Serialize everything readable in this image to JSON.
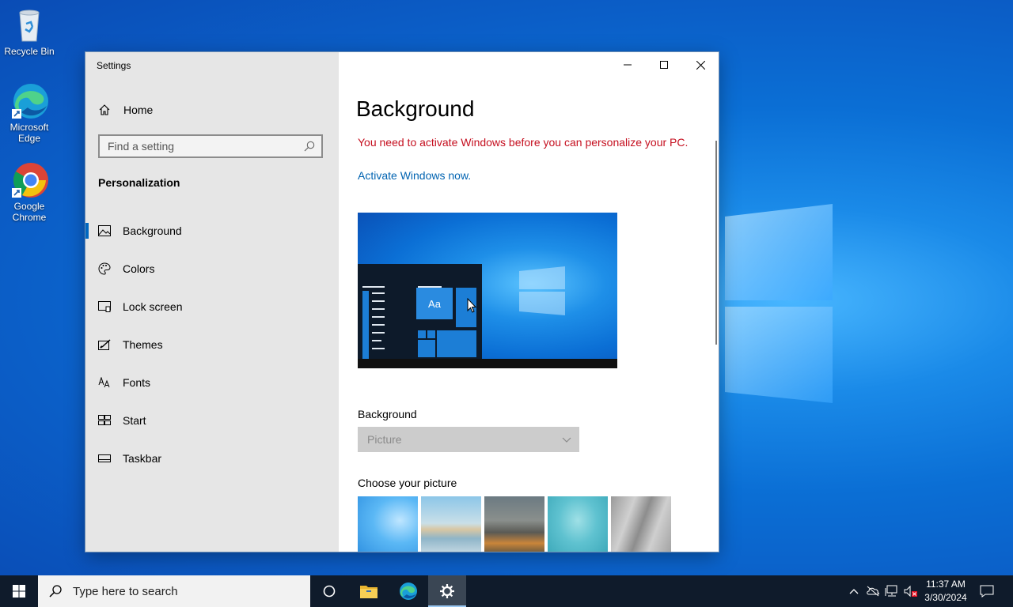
{
  "desktop": {
    "icons": [
      {
        "label_line1": "Recycle Bin",
        "label_line2": ""
      },
      {
        "label_line1": "Microsoft",
        "label_line2": "Edge"
      },
      {
        "label_line1": "Google",
        "label_line2": "Chrome"
      }
    ]
  },
  "window": {
    "title": "Settings",
    "controls": {
      "minimize": "minimize-icon",
      "maximize": "maximize-icon",
      "close": "close-icon"
    }
  },
  "sidebar": {
    "home_label": "Home",
    "search_placeholder": "Find a setting",
    "section_title": "Personalization",
    "items": [
      {
        "label": "Background",
        "icon": "picture-icon",
        "active": true
      },
      {
        "label": "Colors",
        "icon": "palette-icon",
        "active": false
      },
      {
        "label": "Lock screen",
        "icon": "lock-screen-icon",
        "active": false
      },
      {
        "label": "Themes",
        "icon": "themes-icon",
        "active": false
      },
      {
        "label": "Fonts",
        "icon": "fonts-icon",
        "active": false
      },
      {
        "label": "Start",
        "icon": "start-icon",
        "active": false
      },
      {
        "label": "Taskbar",
        "icon": "taskbar-icon",
        "active": false
      }
    ]
  },
  "main": {
    "title": "Background",
    "activation_warning": "You need to activate Windows before you can personalize your PC.",
    "activate_link": "Activate Windows now.",
    "preview_sample_text": "Aa",
    "background_label": "Background",
    "background_value": "Picture",
    "choose_picture_label": "Choose your picture",
    "picture_count": 5
  },
  "taskbar": {
    "search_placeholder": "Type here to search",
    "apps": [
      "cortana-icon",
      "file-explorer-icon",
      "edge-icon",
      "settings-icon"
    ],
    "active_app": "settings-icon",
    "clock_time": "11:37 AM",
    "clock_date": "3/30/2024"
  },
  "colors": {
    "accent": "#0067c0",
    "warning": "#c50f1f",
    "link": "#0063b1",
    "taskbar": "#0f1b2b"
  }
}
